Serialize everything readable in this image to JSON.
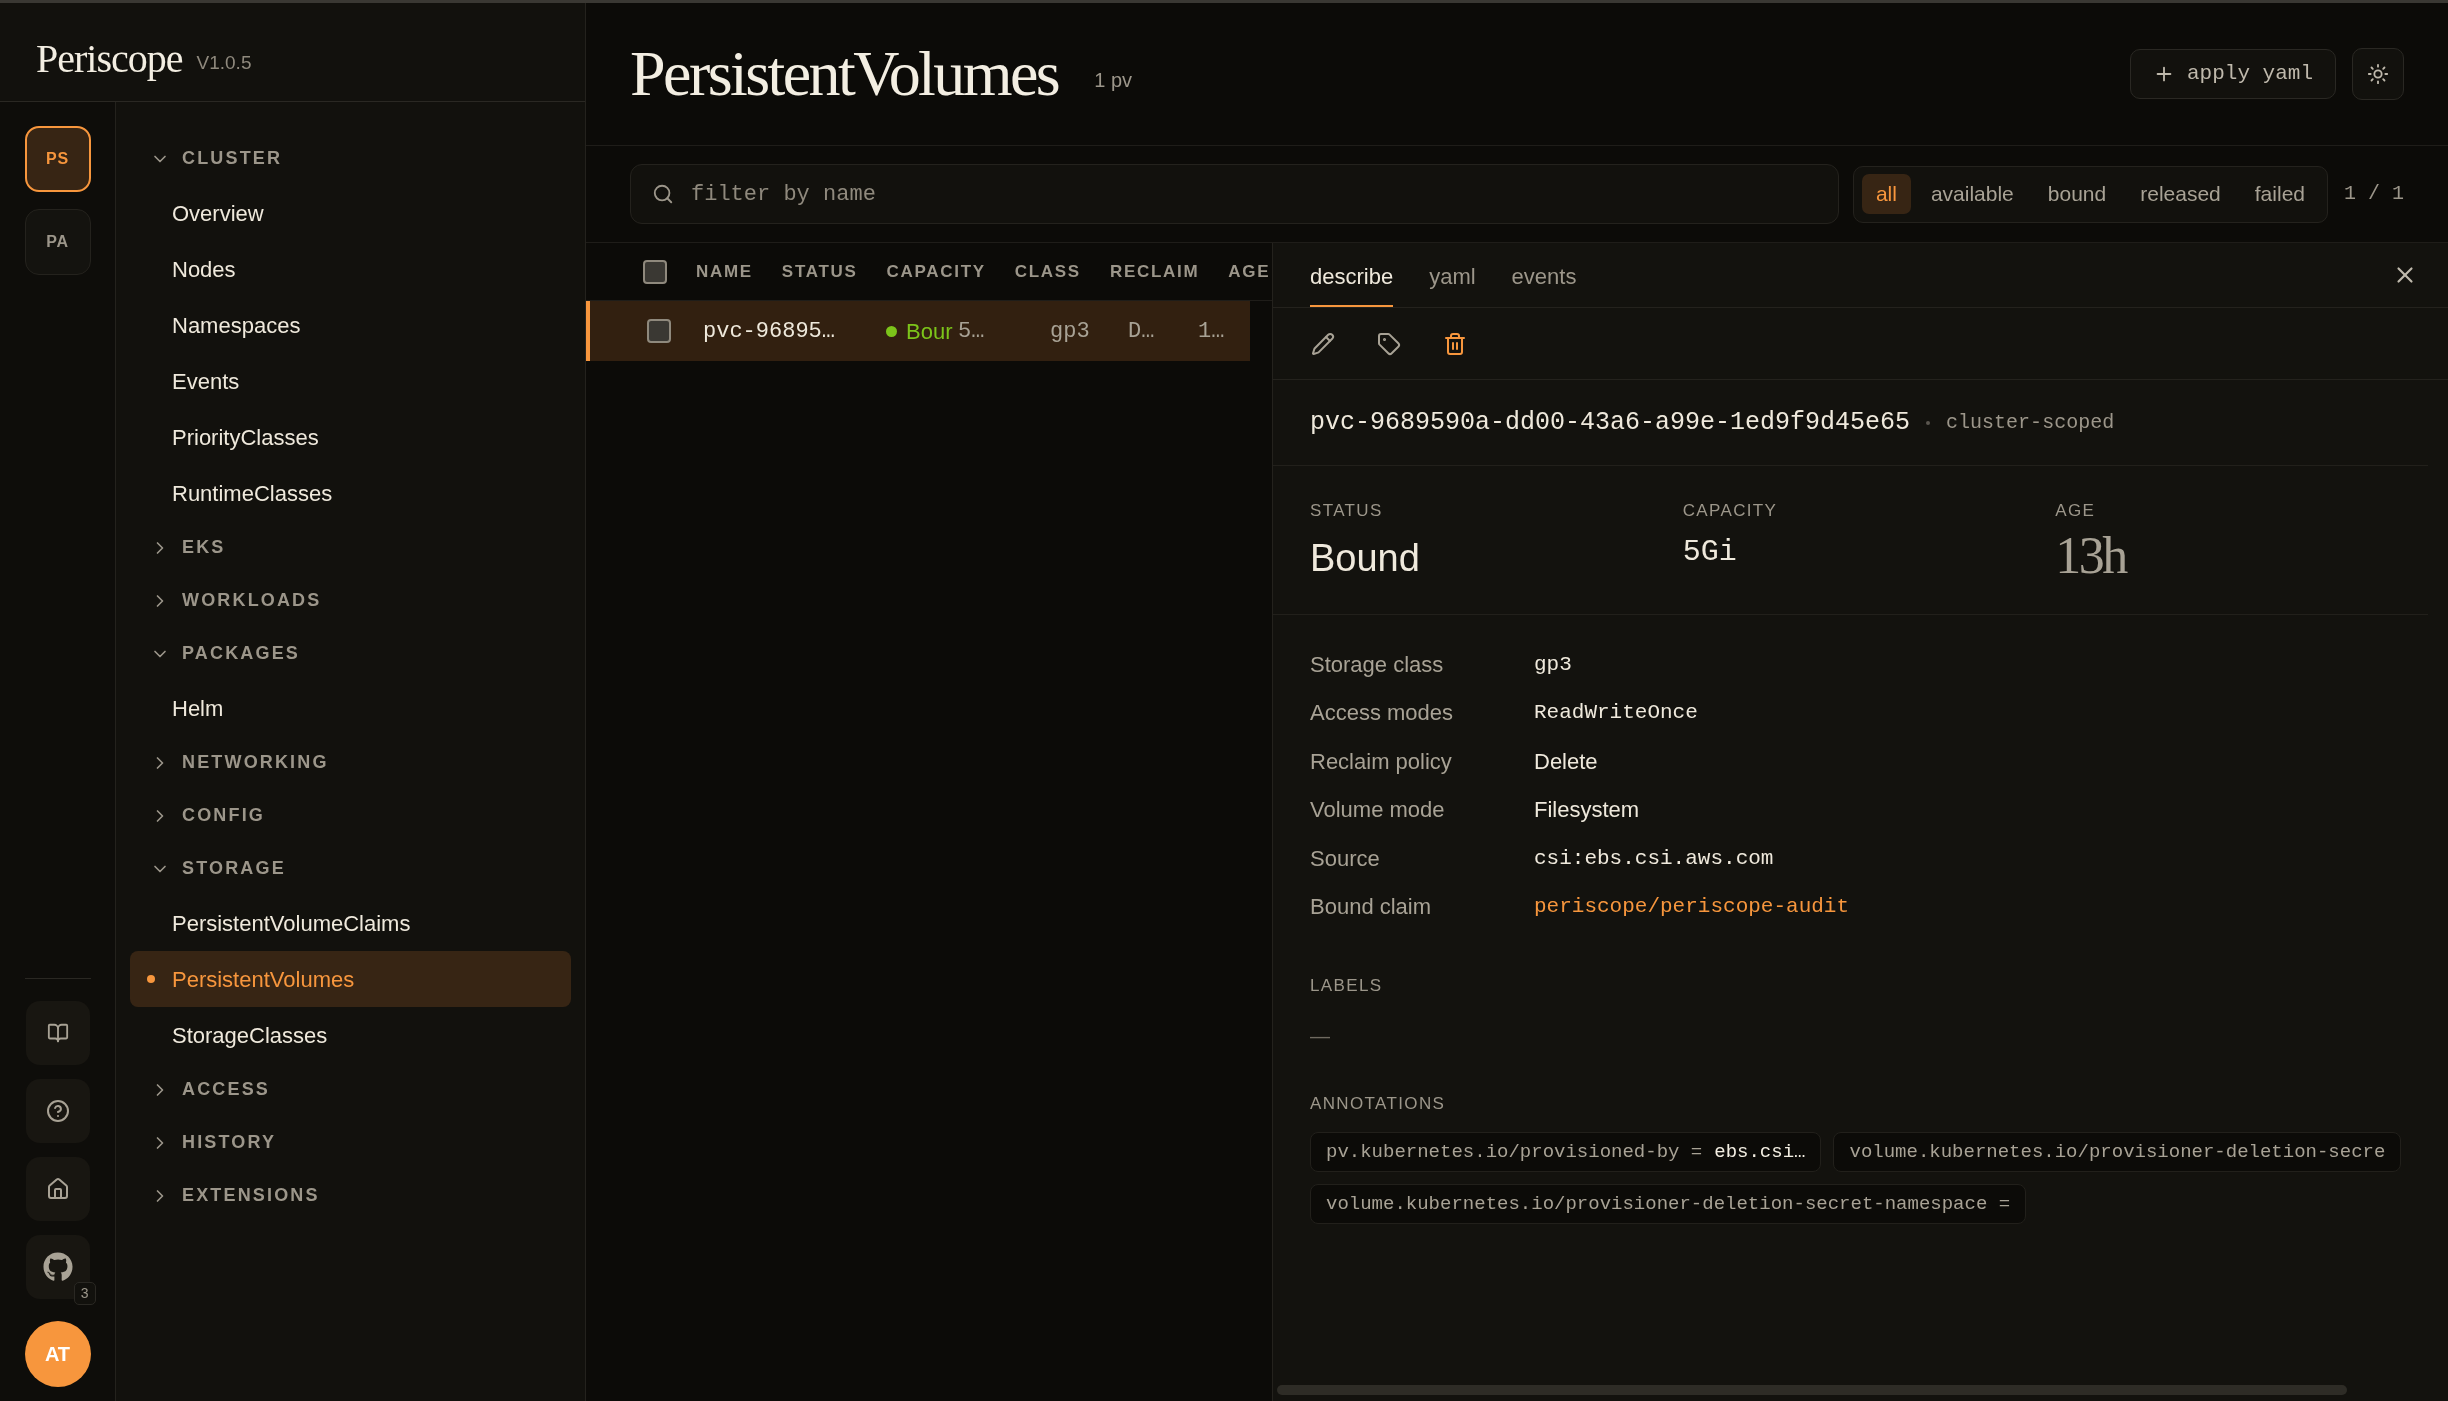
{
  "app": {
    "name": "Periscope",
    "version": "V1.0.5"
  },
  "rail": {
    "workspaces": [
      {
        "label": "PS",
        "selected": true
      },
      {
        "label": "PA",
        "selected": false
      }
    ],
    "github_badge": "3",
    "avatar": "AT"
  },
  "nav": [
    {
      "label": "CLUSTER",
      "expanded": true,
      "children": [
        {
          "label": "Overview",
          "selected": false
        },
        {
          "label": "Nodes",
          "selected": false
        },
        {
          "label": "Namespaces",
          "selected": false
        },
        {
          "label": "Events",
          "selected": false
        },
        {
          "label": "PriorityClasses",
          "selected": false
        },
        {
          "label": "RuntimeClasses",
          "selected": false
        }
      ]
    },
    {
      "label": "EKS",
      "expanded": false
    },
    {
      "label": "WORKLOADS",
      "expanded": false
    },
    {
      "label": "PACKAGES",
      "expanded": true,
      "children": [
        {
          "label": "Helm",
          "selected": false
        }
      ]
    },
    {
      "label": "NETWORKING",
      "expanded": false
    },
    {
      "label": "CONFIG",
      "expanded": false
    },
    {
      "label": "STORAGE",
      "expanded": true,
      "children": [
        {
          "label": "PersistentVolumeClaims",
          "selected": false
        },
        {
          "label": "PersistentVolumes",
          "selected": true
        },
        {
          "label": "StorageClasses",
          "selected": false
        }
      ]
    },
    {
      "label": "ACCESS",
      "expanded": false
    },
    {
      "label": "HISTORY",
      "expanded": false
    },
    {
      "label": "EXTENSIONS",
      "expanded": false
    }
  ],
  "page": {
    "title": "PersistentVolumes",
    "count": "1 pv",
    "apply_button": "apply yaml"
  },
  "filter": {
    "placeholder": "filter by name",
    "options": [
      {
        "label": "all",
        "selected": true
      },
      {
        "label": "available",
        "selected": false
      },
      {
        "label": "bound",
        "selected": false
      },
      {
        "label": "released",
        "selected": false
      },
      {
        "label": "failed",
        "selected": false
      }
    ],
    "pager": "1 / 1"
  },
  "table": {
    "select_all_checked": false,
    "columns": [
      "NAME",
      "STATUS",
      "CAPACITY",
      "CLASS",
      "RECLAIM",
      "AGE"
    ],
    "rows": [
      {
        "selected": true,
        "checked": false,
        "name": "pvc-96895…",
        "status": "Bour",
        "color": "#7cc41a",
        "capacity": "5…",
        "class": "gp3",
        "reclaim": "D…",
        "age": "1…"
      }
    ]
  },
  "detail": {
    "tabs": [
      {
        "label": "describe",
        "selected": true
      },
      {
        "label": "yaml",
        "selected": false
      },
      {
        "label": "events",
        "selected": false
      }
    ],
    "name": "pvc-9689590a-dd00-43a6-a99e-1ed9f9d45e65",
    "scope": "cluster-scoped",
    "stats": [
      {
        "label": "STATUS",
        "value": "Bound",
        "kind": "text"
      },
      {
        "label": "CAPACITY",
        "value": "5Gi",
        "kind": "mono"
      },
      {
        "label": "AGE",
        "value": "13h",
        "kind": "serif"
      }
    ],
    "properties": [
      {
        "label": "Storage class",
        "value": "gp3",
        "kind": "mono"
      },
      {
        "label": "Access modes",
        "value": "ReadWriteOnce",
        "kind": "mono"
      },
      {
        "label": "Reclaim policy",
        "value": "Delete",
        "kind": "text"
      },
      {
        "label": "Volume mode",
        "value": "Filesystem",
        "kind": "text"
      },
      {
        "label": "Source",
        "value": "csi:ebs.csi.aws.com",
        "kind": "mono"
      },
      {
        "label": "Bound claim",
        "value": "periscope/periscope-audit",
        "kind": "link"
      }
    ],
    "labels_heading": "LABELS",
    "labels_empty": "—",
    "annotations_heading": "ANNOTATIONS",
    "annotations": [
      {
        "key": "pv.kubernetes.io/provisioned-by =",
        "value": "ebs.csi…"
      },
      {
        "key": "volume.kubernetes.io/provisioner-deletion-secre"
      },
      {
        "key": "volume.kubernetes.io/provisioner-deletion-secret-namespace ="
      }
    ]
  }
}
